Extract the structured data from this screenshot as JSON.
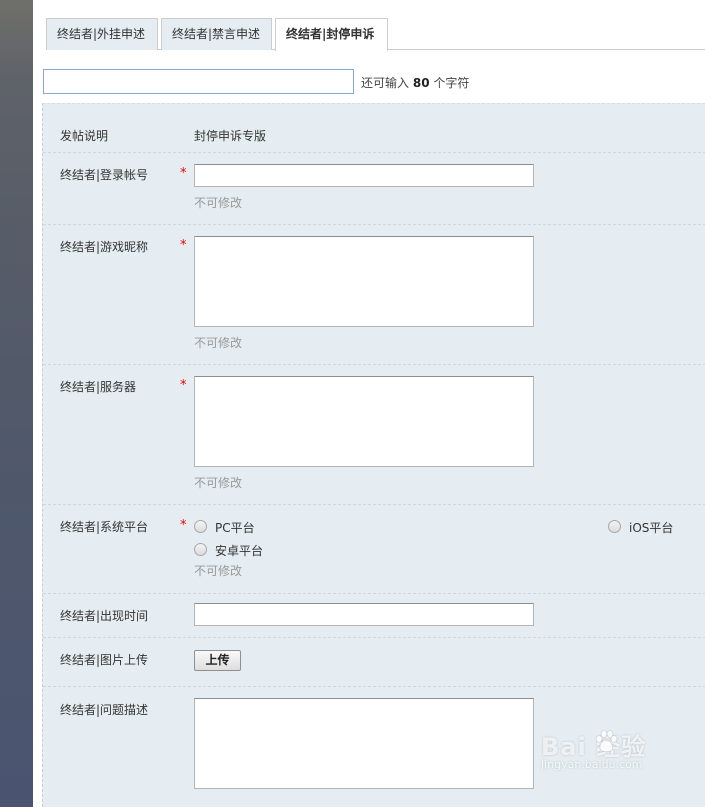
{
  "tabs": [
    {
      "label": "终结者|外挂申述"
    },
    {
      "label": "终结者|禁言申述"
    },
    {
      "label": "终结者|封停申诉"
    }
  ],
  "title": {
    "value": "",
    "hint_prefix": "还可输入",
    "hint_count": "80",
    "hint_suffix": "个字符"
  },
  "form": {
    "post_note": {
      "label": "发帖说明",
      "value": "封停申诉专版"
    },
    "account": {
      "label": "终结者|登录帐号",
      "required": "*",
      "note": "不可修改"
    },
    "nickname": {
      "label": "终结者|游戏昵称",
      "required": "*",
      "note": "不可修改"
    },
    "server": {
      "label": "终结者|服务器",
      "required": "*",
      "note": "不可修改"
    },
    "platform": {
      "label": "终结者|系统平台",
      "required": "*",
      "note": "不可修改",
      "options": [
        {
          "label": "PC平台"
        },
        {
          "label": "iOS平台"
        },
        {
          "label": "安卓平台"
        }
      ]
    },
    "time": {
      "label": "终结者|出现时间"
    },
    "image": {
      "label": "终结者|图片上传",
      "button": "上传"
    },
    "description": {
      "label": "终结者|问题描述"
    }
  },
  "watermark": {
    "main": "Bai  经验",
    "sub": "jingyan.baidu.com"
  },
  "colors": {
    "form_bg": "#e5edf2",
    "required": "#e00000",
    "input_focus_border": "#86a5d0"
  }
}
